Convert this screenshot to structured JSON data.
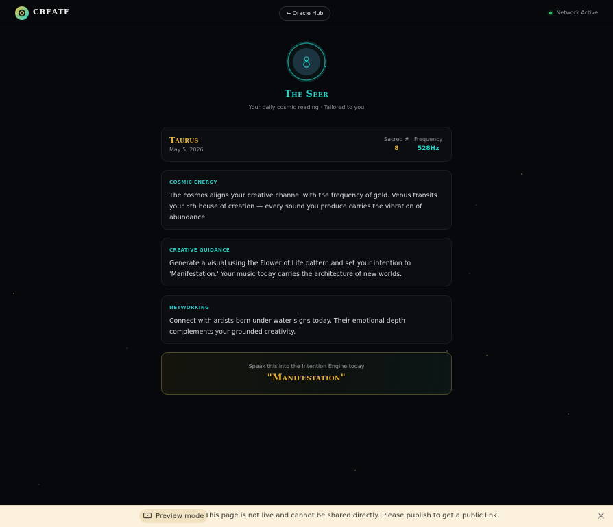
{
  "header": {
    "brand": "CREATE",
    "hub_button": "← Oracle Hub",
    "status": "Network Active"
  },
  "oracle": {
    "title": "The Seer",
    "subtitle": "Your daily cosmic reading · Tailored to you"
  },
  "sign": {
    "name": "Taurus",
    "date": "May 5, 2026",
    "sacred_label": "Sacred #",
    "sacred_value": "8",
    "frequency_label": "Frequency",
    "frequency_value": "528Hz"
  },
  "sections": [
    {
      "label": "COSMIC ENERGY",
      "text": "The cosmos aligns your creative channel with the frequency of gold. Venus transits your 5th house of creation — every sound you produce carries the vibration of abundance."
    },
    {
      "label": "CREATIVE GUIDANCE",
      "text": "Generate a visual using the Flower of Life pattern and set your intention to 'Manifestation.' Your music today carries the architecture of new worlds."
    },
    {
      "label": "NETWORKING",
      "text": "Connect with artists born under water signs today. Their emotional depth complements your grounded creativity."
    }
  ],
  "intention": {
    "label": "Speak this into the Intention Engine today",
    "word": "\"Manifestation\""
  },
  "banner": {
    "mode": "Preview mode",
    "message": "This page is not live and cannot be shared directly. Please publish to get a public link."
  },
  "colors": {
    "accent_teal": "#2ad0c9",
    "accent_gold": "#e7b43a",
    "status_green": "#35c46a",
    "background": "#07080b"
  },
  "icons": {
    "logo": "hexagon-logo-icon",
    "avatar": "seer-person-icon",
    "network": "status-dot-icon",
    "preview": "monitor-icon",
    "close": "close-icon"
  }
}
